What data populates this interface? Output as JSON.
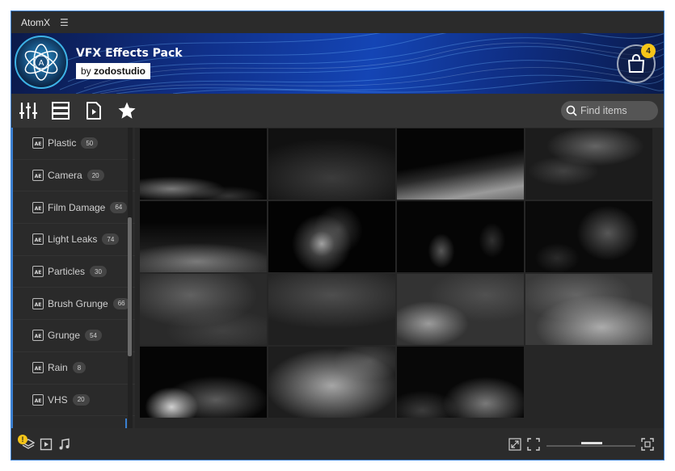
{
  "app": {
    "title": "AtomX",
    "menu_icon": "hamburger-icon"
  },
  "banner": {
    "logo_letter": "A",
    "pack_title": "VFX Effects Pack",
    "author_prefix": "by",
    "author_name": "zodostudio",
    "cart_count": "4"
  },
  "toolbar": {
    "icons": [
      "sliders-icon",
      "list-view-icon",
      "media-file-icon",
      "star-icon"
    ],
    "search_placeholder": "Find items"
  },
  "sidebar": {
    "categories": [
      {
        "label": "Plastic",
        "count": "50"
      },
      {
        "label": "Camera",
        "count": "20"
      },
      {
        "label": "Film Damage",
        "count": "64"
      },
      {
        "label": "Light Leaks",
        "count": "74"
      },
      {
        "label": "Particles",
        "count": "30"
      },
      {
        "label": "Brush Grunge",
        "count": "66"
      },
      {
        "label": "Grunge",
        "count": "54"
      },
      {
        "label": "Rain",
        "count": "8"
      },
      {
        "label": "VHS",
        "count": "20"
      }
    ]
  },
  "grid": {
    "item_count": 15,
    "thumbnail_style": "white smoke on black"
  },
  "statusbar": {
    "warning_count": "!",
    "left_icons": [
      "layers-icon",
      "play-icon",
      "music-icon"
    ],
    "right_icons": [
      "expand-icon",
      "fit-icon",
      "fullscreen-icon"
    ]
  },
  "colors": {
    "accent": "#3a7fd0",
    "badge": "#f5c518",
    "background": "#262626"
  }
}
